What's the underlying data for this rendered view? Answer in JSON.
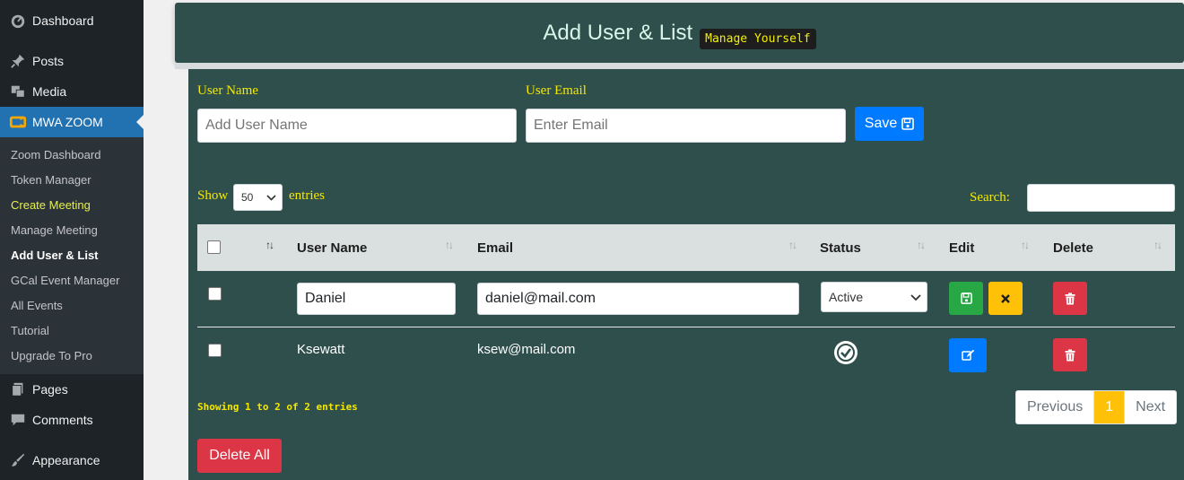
{
  "sidebar": {
    "top_items": [
      {
        "label": "Dashboard",
        "icon": "dashboard-icon"
      },
      {
        "label": "Posts",
        "icon": "pin-icon"
      },
      {
        "label": "Media",
        "icon": "media-icon"
      }
    ],
    "active_item": {
      "label": "MWA ZOOM",
      "icon": "zoom-icon"
    },
    "submenu": [
      "Zoom Dashboard",
      "Token Manager",
      "Create Meeting",
      "Manage Meeting",
      "Add User & List",
      "GCal Event Manager",
      "All Events",
      "Tutorial",
      "Upgrade To Pro"
    ],
    "bottom_items": [
      {
        "label": "Pages",
        "icon": "pages-icon"
      },
      {
        "label": "Comments",
        "icon": "comment-icon"
      },
      {
        "label": "Appearance",
        "icon": "brush-icon"
      }
    ]
  },
  "header": {
    "title": "Add User & List",
    "badge": "Manage Yourself"
  },
  "form": {
    "name_label": "User Name",
    "name_placeholder": "Add User Name",
    "email_label": "User Email",
    "email_placeholder": "Enter Email",
    "save_label": "Save"
  },
  "table_controls": {
    "show_label": "Show",
    "entries_value": "50",
    "entries_label": "entries",
    "search_label": "Search:"
  },
  "table": {
    "columns": [
      "User Name",
      "Email",
      "Status",
      "Edit",
      "Delete"
    ],
    "rows": [
      {
        "name": "Daniel",
        "email": "daniel@mail.com",
        "status": "Active",
        "editing": true
      },
      {
        "name": "Ksewatt",
        "email": "ksew@mail.com",
        "status": "active",
        "editing": false
      }
    ]
  },
  "footer": {
    "info": "Showing 1 to 2 of 2 entries",
    "prev_label": "Previous",
    "page": "1",
    "next_label": "Next",
    "delete_all_label": "Delete All"
  },
  "colors": {
    "panel": "#2f4f4c",
    "accent_text": "#f5e800",
    "sidebar": "#1d2327",
    "active": "#2271b1"
  }
}
